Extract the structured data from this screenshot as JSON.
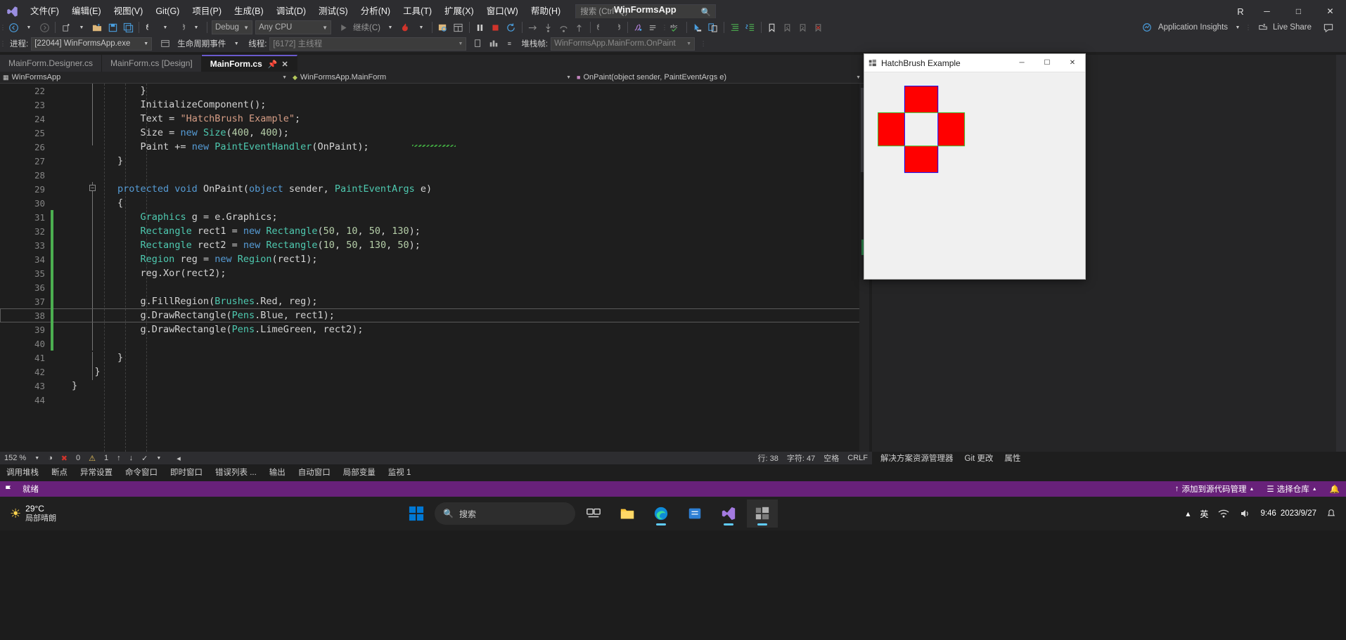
{
  "window": {
    "app_title": "WinFormsApp",
    "account_initial": "R",
    "minimize": "─",
    "maximize": "□",
    "close": "✕"
  },
  "menu": {
    "items": [
      {
        "label": "文件(F)",
        "name": "menu-file"
      },
      {
        "label": "编辑(E)",
        "name": "menu-edit"
      },
      {
        "label": "视图(V)",
        "name": "menu-view"
      },
      {
        "label": "Git(G)",
        "name": "menu-git"
      },
      {
        "label": "项目(P)",
        "name": "menu-project"
      },
      {
        "label": "生成(B)",
        "name": "menu-build"
      },
      {
        "label": "调试(D)",
        "name": "menu-debug"
      },
      {
        "label": "测试(S)",
        "name": "menu-test"
      },
      {
        "label": "分析(N)",
        "name": "menu-analyze"
      },
      {
        "label": "工具(T)",
        "name": "menu-tools"
      },
      {
        "label": "扩展(X)",
        "name": "menu-extensions"
      },
      {
        "label": "窗口(W)",
        "name": "menu-window"
      },
      {
        "label": "帮助(H)",
        "name": "menu-help"
      }
    ],
    "search_placeholder": "搜索 (Ctrl+Q)"
  },
  "toolbar": {
    "config": "Debug",
    "platform": "Any CPU",
    "continue_label": "继续(C)",
    "live_share": "Live Share",
    "app_insights": "Application Insights"
  },
  "debugbar": {
    "process_label": "进程:",
    "process_value": "[22044] WinFormsApp.exe",
    "lifecycle_label": "生命周期事件",
    "thread_label": "线程:",
    "thread_value": "[6172] 主线程",
    "stackframe_label": "堆栈帧:",
    "stackframe_value": "WinFormsApp.MainForm.OnPaint"
  },
  "tabs": [
    {
      "label": "MainForm.Designer.cs",
      "active": false
    },
    {
      "label": "MainForm.cs [Design]",
      "active": false
    },
    {
      "label": "MainForm.cs",
      "active": true
    }
  ],
  "navbar": {
    "project": "WinFormsApp",
    "type": "WinFormsApp.MainForm",
    "member": "OnPaint(object sender, PaintEventArgs e)"
  },
  "code": {
    "first_line": 22,
    "current_line": 38,
    "lines": [
      {
        "n": 22,
        "tokens": [
          {
            "t": "            }",
            "c": "p"
          }
        ],
        "change": "none"
      },
      {
        "n": 23,
        "tokens": [
          {
            "t": "            InitializeComponent();",
            "c": "p"
          }
        ],
        "change": "none"
      },
      {
        "n": 24,
        "tokens": [
          {
            "t": "            Text = ",
            "c": "p"
          },
          {
            "t": "\"HatchBrush Example\"",
            "c": "s"
          },
          {
            "t": ";",
            "c": "p"
          }
        ],
        "change": "none"
      },
      {
        "n": 25,
        "tokens": [
          {
            "t": "            Size = ",
            "c": "p"
          },
          {
            "t": "new ",
            "c": "k"
          },
          {
            "t": "Size",
            "c": "t"
          },
          {
            "t": "(",
            "c": "p"
          },
          {
            "t": "400",
            "c": "n"
          },
          {
            "t": ", ",
            "c": "p"
          },
          {
            "t": "400",
            "c": "n"
          },
          {
            "t": ");",
            "c": "p"
          }
        ],
        "change": "none"
      },
      {
        "n": 26,
        "tokens": [
          {
            "t": "            Paint += ",
            "c": "p"
          },
          {
            "t": "new ",
            "c": "k"
          },
          {
            "t": "PaintEventHandler",
            "c": "t"
          },
          {
            "t": "(OnPaint);",
            "c": "p"
          }
        ],
        "change": "none"
      },
      {
        "n": 27,
        "tokens": [
          {
            "t": "        }",
            "c": "p"
          }
        ],
        "change": "none"
      },
      {
        "n": 28,
        "tokens": [
          {
            "t": "",
            "c": "p"
          }
        ],
        "change": "none"
      },
      {
        "n": 29,
        "tokens": [
          {
            "t": "        protected void ",
            "c": "k"
          },
          {
            "t": "OnPaint(",
            "c": "p"
          },
          {
            "t": "object ",
            "c": "k"
          },
          {
            "t": "sender, ",
            "c": "p"
          },
          {
            "t": "PaintEventArgs",
            "c": "t"
          },
          {
            "t": " e)",
            "c": "p"
          }
        ],
        "change": "none"
      },
      {
        "n": 30,
        "tokens": [
          {
            "t": "        {",
            "c": "p"
          }
        ],
        "change": "none"
      },
      {
        "n": 31,
        "tokens": [
          {
            "t": "            ",
            "c": "p"
          },
          {
            "t": "Graphics",
            "c": "t"
          },
          {
            "t": " g = e.Graphics;",
            "c": "p"
          }
        ],
        "change": "green"
      },
      {
        "n": 32,
        "tokens": [
          {
            "t": "            ",
            "c": "p"
          },
          {
            "t": "Rectangle",
            "c": "t"
          },
          {
            "t": " rect1 = ",
            "c": "p"
          },
          {
            "t": "new ",
            "c": "k"
          },
          {
            "t": "Rectangle",
            "c": "t"
          },
          {
            "t": "(",
            "c": "p"
          },
          {
            "t": "50",
            "c": "n"
          },
          {
            "t": ", ",
            "c": "p"
          },
          {
            "t": "10",
            "c": "n"
          },
          {
            "t": ", ",
            "c": "p"
          },
          {
            "t": "50",
            "c": "n"
          },
          {
            "t": ", ",
            "c": "p"
          },
          {
            "t": "130",
            "c": "n"
          },
          {
            "t": ");",
            "c": "p"
          }
        ],
        "change": "green"
      },
      {
        "n": 33,
        "tokens": [
          {
            "t": "            ",
            "c": "p"
          },
          {
            "t": "Rectangle",
            "c": "t"
          },
          {
            "t": " rect2 = ",
            "c": "p"
          },
          {
            "t": "new ",
            "c": "k"
          },
          {
            "t": "Rectangle",
            "c": "t"
          },
          {
            "t": "(",
            "c": "p"
          },
          {
            "t": "10",
            "c": "n"
          },
          {
            "t": ", ",
            "c": "p"
          },
          {
            "t": "50",
            "c": "n"
          },
          {
            "t": ", ",
            "c": "p"
          },
          {
            "t": "130",
            "c": "n"
          },
          {
            "t": ", ",
            "c": "p"
          },
          {
            "t": "50",
            "c": "n"
          },
          {
            "t": ");",
            "c": "p"
          }
        ],
        "change": "green"
      },
      {
        "n": 34,
        "tokens": [
          {
            "t": "            ",
            "c": "p"
          },
          {
            "t": "Region",
            "c": "t"
          },
          {
            "t": " reg = ",
            "c": "p"
          },
          {
            "t": "new ",
            "c": "k"
          },
          {
            "t": "Region",
            "c": "t"
          },
          {
            "t": "(rect1);",
            "c": "p"
          }
        ],
        "change": "green"
      },
      {
        "n": 35,
        "tokens": [
          {
            "t": "            reg.Xor(rect2);",
            "c": "p"
          }
        ],
        "change": "green"
      },
      {
        "n": 36,
        "tokens": [
          {
            "t": "",
            "c": "p"
          }
        ],
        "change": "green"
      },
      {
        "n": 37,
        "tokens": [
          {
            "t": "            g.FillRegion(",
            "c": "p"
          },
          {
            "t": "Brushes",
            "c": "t"
          },
          {
            "t": ".Red, reg);",
            "c": "p"
          }
        ],
        "change": "green"
      },
      {
        "n": 38,
        "tokens": [
          {
            "t": "            g.DrawRectangle(",
            "c": "p"
          },
          {
            "t": "Pens",
            "c": "t"
          },
          {
            "t": ".Blue, rect1);",
            "c": "p"
          }
        ],
        "change": "green"
      },
      {
        "n": 39,
        "tokens": [
          {
            "t": "            g.DrawRectangle(",
            "c": "p"
          },
          {
            "t": "Pens",
            "c": "t"
          },
          {
            "t": ".LimeGreen, rect2);",
            "c": "p"
          }
        ],
        "change": "green"
      },
      {
        "n": 40,
        "tokens": [
          {
            "t": "",
            "c": "p"
          }
        ],
        "change": "green"
      },
      {
        "n": 41,
        "tokens": [
          {
            "t": "        }",
            "c": "p"
          }
        ],
        "change": "none"
      },
      {
        "n": 42,
        "tokens": [
          {
            "t": "    }",
            "c": "p"
          }
        ],
        "change": "none"
      },
      {
        "n": 43,
        "tokens": [
          {
            "t": "}",
            "c": "p"
          }
        ],
        "change": "none"
      },
      {
        "n": 44,
        "tokens": [
          {
            "t": "",
            "c": "p"
          }
        ],
        "change": "none"
      }
    ]
  },
  "editor_status": {
    "zoom": "152 %",
    "errors": "0",
    "warnings": "1",
    "line": "行: 38",
    "col": "字符: 47",
    "spaces": "空格",
    "eol": "CRLF"
  },
  "dock_tabs": [
    "调用堆栈",
    "断点",
    "异常设置",
    "命令窗口",
    "即时窗口",
    "错误列表 ...",
    "输出",
    "自动窗口",
    "局部变量",
    "监视 1"
  ],
  "right_dock_tabs": [
    "解决方案资源管理器",
    "Git 更改",
    "属性"
  ],
  "app_window": {
    "title": "HatchBrush Example",
    "minimize": "─",
    "maximize": "☐",
    "close": "✕",
    "shape_fill": "#FF0000",
    "shape_outline_blue": "#0000FF",
    "shape_outline_green": "#32CD32"
  },
  "status_bar": {
    "ready": "就绪",
    "add_source_control": "添加到源代码管理",
    "select_repo": "选择仓库",
    "accent": "#68217a"
  },
  "taskbar": {
    "weather_temp": "29°C",
    "weather_desc": "局部晴朗",
    "search_placeholder": "搜索",
    "ime": "英",
    "time": "9:46",
    "date": "2023/9/27"
  }
}
